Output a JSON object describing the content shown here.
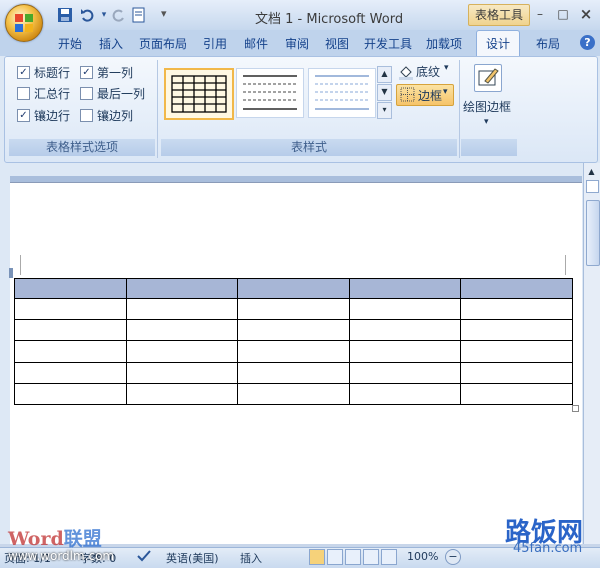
{
  "window": {
    "title": "文档 1 - Microsoft Word",
    "contextual_tab_group": "表格工具",
    "controls": {
      "minimize": "–",
      "maximize": "□",
      "close": "×"
    }
  },
  "qat": {
    "more": "▾"
  },
  "tabs": [
    "开始",
    "插入",
    "页面布局",
    "引用",
    "邮件",
    "审阅",
    "视图",
    "开发工具",
    "加载项",
    "设计",
    "布局"
  ],
  "active_tab": "设计",
  "ribbon": {
    "style_options": {
      "label": "表格样式选项",
      "items": [
        {
          "label": "标题行",
          "checked": true
        },
        {
          "label": "第一列",
          "checked": true
        },
        {
          "label": "汇总行",
          "checked": false
        },
        {
          "label": "最后一列",
          "checked": false
        },
        {
          "label": "镶边行",
          "checked": true
        },
        {
          "label": "镶边列",
          "checked": false
        }
      ]
    },
    "table_styles": {
      "label": "表样式",
      "shading_label": "底纹",
      "border_label": "边框"
    },
    "draw": {
      "label": "绘图边框"
    }
  },
  "document": {
    "table": {
      "rows": 6,
      "cols": 5
    }
  },
  "statusbar": {
    "page": "页面: 1/1",
    "words": "字数: 0",
    "language": "英语(美国)",
    "mode": "插入",
    "zoom": "100%"
  },
  "watermarks": {
    "word_brand_a": "Word",
    "word_brand_b": "联盟",
    "word_site": "www.wordlm.com",
    "site_brand": "路饭网",
    "site_domain": "45fan.com"
  },
  "colors": {
    "ribbon_bg": "#dbe7f6",
    "header_row": "#a7b6d6",
    "selected_highlight": "#f6c46a"
  }
}
